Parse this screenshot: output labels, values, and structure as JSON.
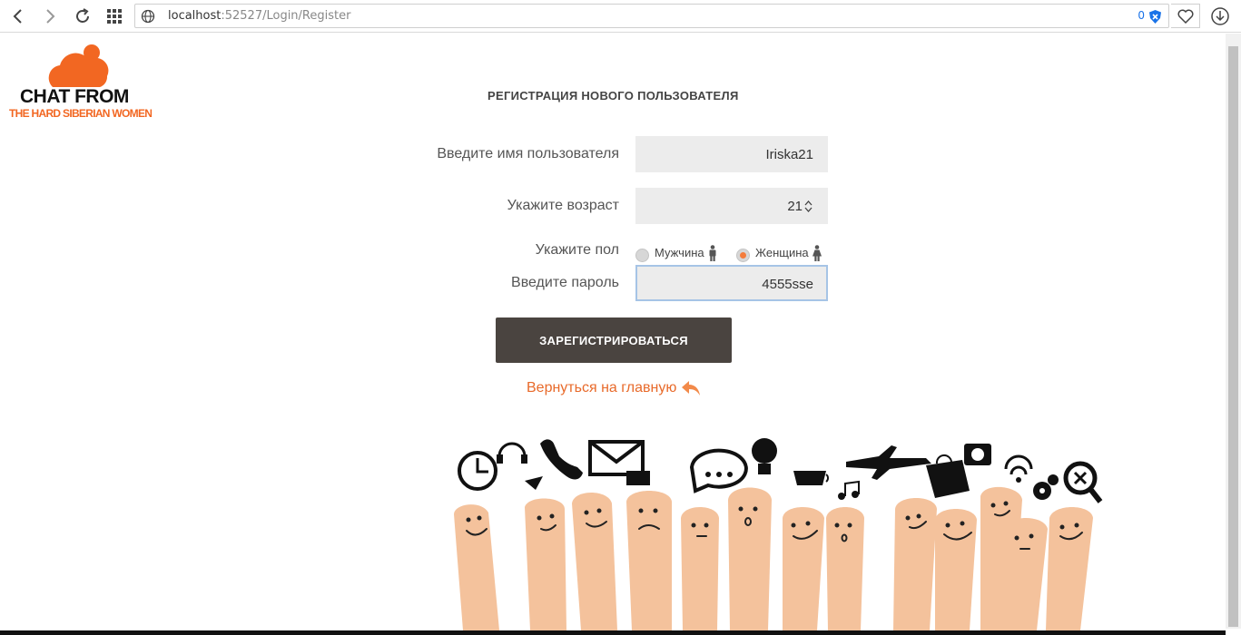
{
  "browser": {
    "url_host": "localhost",
    "url_rest": ":52527/Login/Register",
    "shield_count": "0"
  },
  "logo": {
    "line1": "CHAT FROM",
    "line2": "THE HARD SIBERIAN WOMEN"
  },
  "form": {
    "title": "РЕГИСТРАЦИЯ НОВОГО ПОЛЬЗОВАТЕЛЯ",
    "username_label": "Введите имя пользователя",
    "username_value": "Iriska21",
    "age_label": "Укажите возраст",
    "age_value": "21",
    "gender_label": "Укажите пол",
    "gender_options": [
      "Мужчина",
      "Женщина"
    ],
    "gender_selected": "Женщина",
    "password_label": "Введите пароль",
    "password_value": "4555sse",
    "submit_label": "ЗАРЕГИСТРИРОВАТЬСЯ",
    "back_label": "Вернуться на главную"
  },
  "colors": {
    "accent": "#e86a2a",
    "button": "#4a4440",
    "field_bg": "#ececec"
  }
}
